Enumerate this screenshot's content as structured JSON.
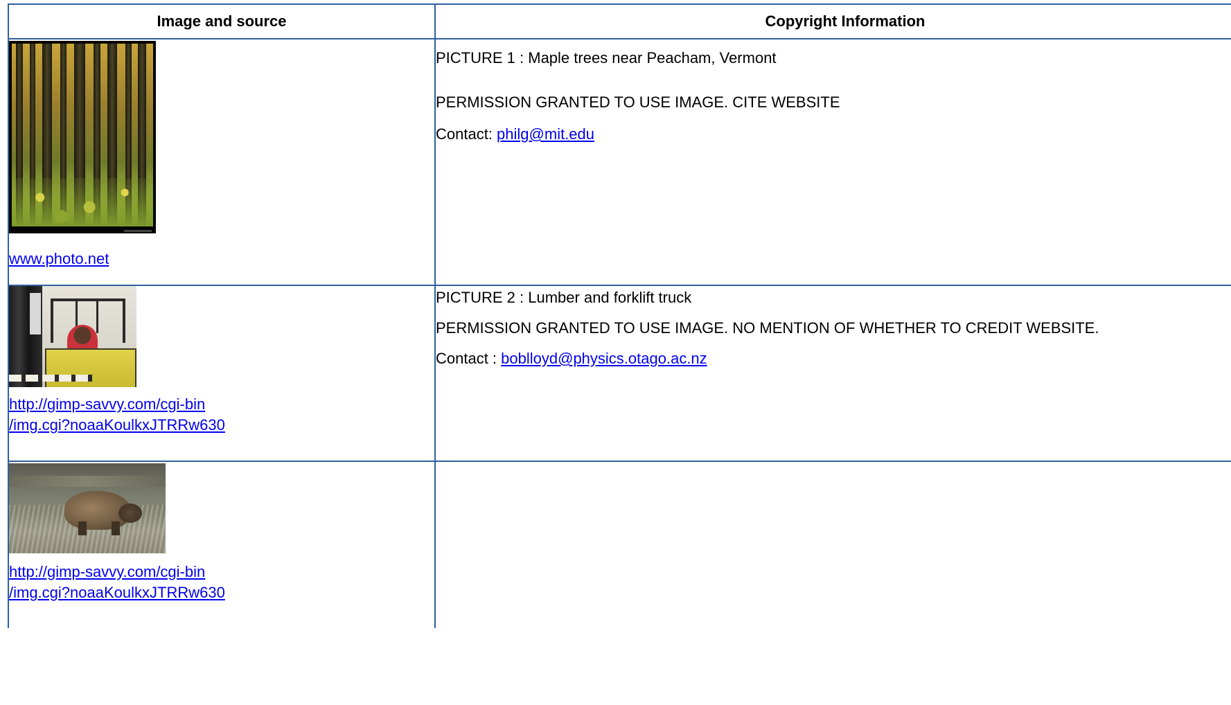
{
  "table": {
    "headers": {
      "image_source": "Image and source",
      "copyright": "Copyright Information"
    },
    "rows": [
      {
        "image_icon": "forest-photo",
        "source_link": [
          "www.photo.net"
        ],
        "info": {
          "title": "PICTURE 1 : Maple trees near Peacham, Vermont",
          "permission": "PERMISSION GRANTED TO USE IMAGE. CITE WEBSITE",
          "contact_label": "Contact: ",
          "contact_email": "philg@mit.edu"
        }
      },
      {
        "image_icon": "forklift-photo",
        "source_link": [
          "http://gimp-savvy.com/cgi-bin",
          "/img.cgi?noaaKoulkxJTRRw630"
        ],
        "info": {
          "title": "PICTURE 2 : Lumber and forklift truck",
          "permission": "PERMISSION GRANTED TO USE IMAGE. NO MENTION OF WHETHER TO CREDIT WEBSITE.",
          "contact_label": "Contact : ",
          "contact_email": "boblloyd@physics.otago.ac.nz"
        }
      },
      {
        "image_icon": "bear-photo",
        "source_link": [
          "http://gimp-savvy.com/cgi-bin",
          "/img.cgi?noaaKoulkxJTRRw630"
        ],
        "info": {
          "title": "",
          "permission": "",
          "contact_label": "",
          "contact_email": ""
        }
      }
    ]
  },
  "colors": {
    "border": "#2f5f9e",
    "link": "#0000ee"
  }
}
